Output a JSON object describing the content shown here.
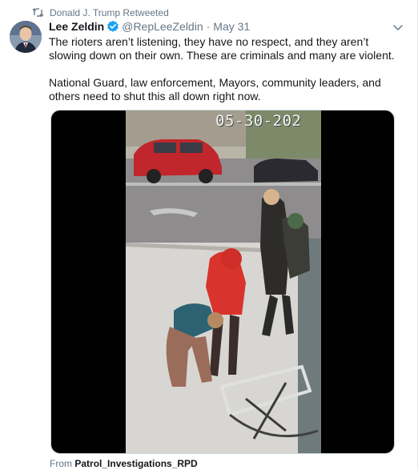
{
  "retweet": {
    "icon": "retweet-icon",
    "label": "Donald J. Trump Retweeted"
  },
  "author": {
    "name": "Lee Zeldin",
    "verified": true,
    "handle": "@RepLeeZeldin",
    "separator": "·",
    "date": "May 31"
  },
  "tweet": {
    "paragraph1": "The rioters aren’t listening, they have no respect, and they aren’t slowing down on their own. These are criminals and many are violent.",
    "paragraph2": "National Guard, law enforcement, Mayors, community leaders, and others need to shut this all down right now."
  },
  "media": {
    "type": "video",
    "overlay_timestamp": "05-30-202"
  },
  "attribution": {
    "prefix": "From",
    "source": "Patrol_Investigations_RPD"
  },
  "colors": {
    "verified": "#1da1f2",
    "secondary_text": "#657786",
    "primary_text": "#14171a"
  }
}
